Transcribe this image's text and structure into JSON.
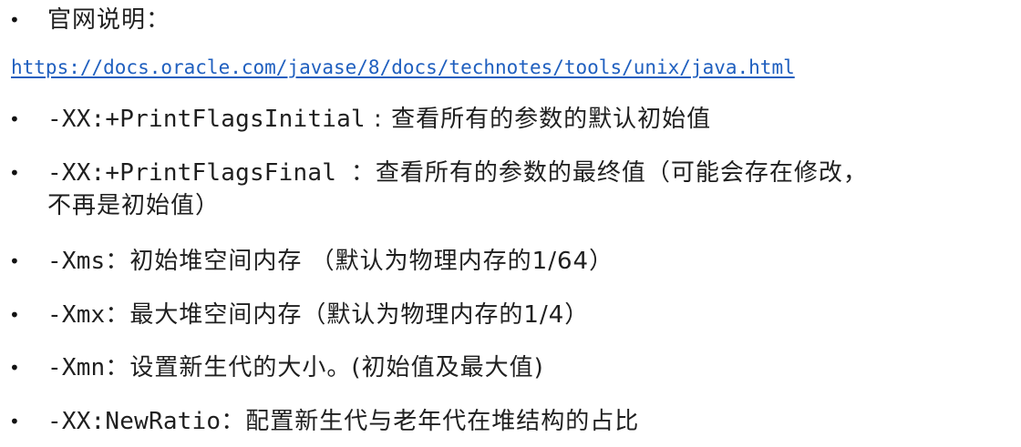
{
  "items": [
    {
      "bullet": "•",
      "label": "官网说明："
    },
    {
      "link": "https://docs.oracle.com/javase/8/docs/technotes/tools/unix/java.html"
    },
    {
      "bullet": "•",
      "code": "-XX:+PrintFlagsInitial",
      "desc": " : 查看所有的参数的默认初始值"
    },
    {
      "bullet": "•",
      "code": "-XX:+PrintFlagsFinal ",
      "desc": " ：查看所有的参数的最终值（可能会存在修改，",
      "desc2": "不再是初始值）"
    },
    {
      "bullet": "•",
      "code": "-Xms",
      "desc": "：初始堆空间内存 （默认为物理内存的1/64）"
    },
    {
      "bullet": "•",
      "code": "-Xmx",
      "desc": "：最大堆空间内存（默认为物理内存的1/4）"
    },
    {
      "bullet": "•",
      "code": "-Xmn",
      "desc": "：设置新生代的大小。(初始值及最大值)"
    },
    {
      "bullet": "•",
      "code": "-XX:NewRatio",
      "desc": "：配置新生代与老年代在堆结构的占比"
    }
  ]
}
